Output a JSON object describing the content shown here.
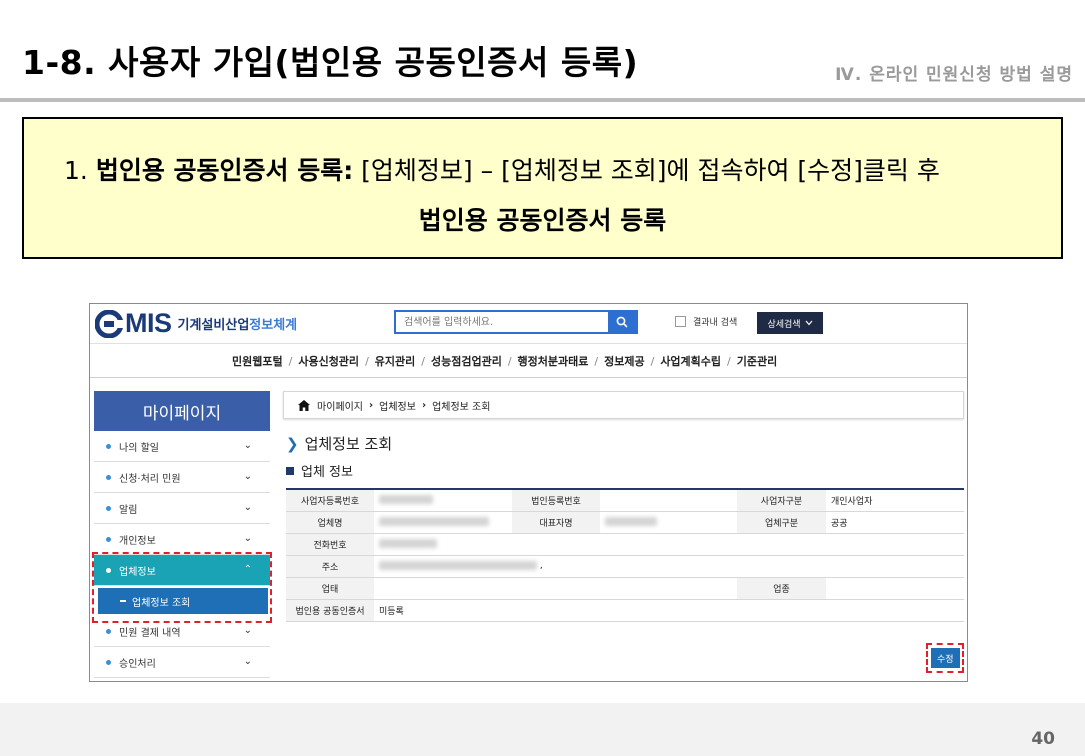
{
  "slide": {
    "title": "1-8. 사용자 가입(법인용 공동인증서 등록)",
    "section": "Ⅳ. 온라인 민원신청 방법 설명",
    "page_number": "40"
  },
  "instruction": {
    "number": "1.",
    "bold_lead": "법인용 공동인증서 등록:",
    "text": " [업체정보] – [업체정보 조회]에 접속하여 [수정]클릭 후",
    "line2": "법인용 공동인증서 등록"
  },
  "app": {
    "logo": {
      "mis": "MIS",
      "name_main": "기계설비산업",
      "name_hl": "정보체계"
    },
    "search": {
      "placeholder": "검색어를 입력하세요.",
      "in_results_label": "결과내 검색",
      "advanced_label": "상세검색"
    },
    "nav": [
      "민원웹포털",
      "사용신청관리",
      "유지관리",
      "성능점검업관리",
      "행정처분과태료",
      "정보제공",
      "사업계획수립",
      "기준관리"
    ],
    "sidebar": {
      "title": "마이페이지",
      "items": [
        {
          "label": "나의 할일"
        },
        {
          "label": "신청·처리 민원"
        },
        {
          "label": "알림"
        },
        {
          "label": "개인정보"
        },
        {
          "label": "업체정보"
        },
        {
          "label": "민원 결제 내역"
        },
        {
          "label": "승인처리"
        }
      ],
      "sub_item": "업체정보 조회"
    },
    "breadcrumb": [
      "마이페이지",
      "업체정보",
      "업체정보 조회"
    ],
    "page_heading": "업체정보 조회",
    "section_heading": "업체 정보",
    "table": {
      "business_reg_no": "사업자등록번호",
      "corp_reg_no": "법인등록번호",
      "business_type_label": "사업자구분",
      "business_type_value": "개인사업자",
      "company_name": "업체명",
      "representative": "대표자명",
      "company_type_label": "업체구분",
      "company_type_value": "공공",
      "phone": "전화번호",
      "address": "주소",
      "address_suffix": ",",
      "category": "업태",
      "item": "업종",
      "cert_label": "법인용 공동인증서",
      "cert_value": "미등록"
    },
    "edit_button": "수정"
  }
}
